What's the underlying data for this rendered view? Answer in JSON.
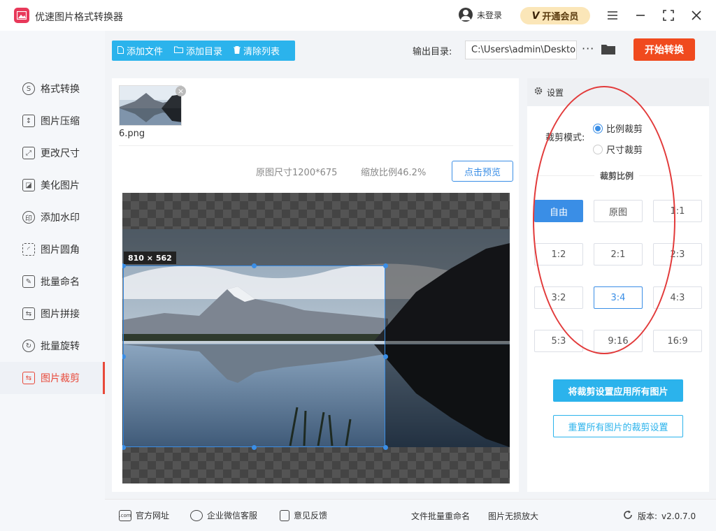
{
  "app": {
    "title": "优速图片格式转换器"
  },
  "header": {
    "login_text": "未登录",
    "vip_mark": "V",
    "vip_label": "开通会员"
  },
  "sidebar": {
    "items": [
      {
        "label": "格式转换",
        "icon": "S"
      },
      {
        "label": "图片压缩",
        "icon": "↕"
      },
      {
        "label": "更改尺寸",
        "icon": "⤢"
      },
      {
        "label": "美化图片",
        "icon": "◪"
      },
      {
        "label": "添加水印",
        "icon": "印"
      },
      {
        "label": "图片圆角",
        "icon": "◜"
      },
      {
        "label": "批量命名",
        "icon": "✎"
      },
      {
        "label": "图片拼接",
        "icon": "⇆"
      },
      {
        "label": "批量旋转",
        "icon": "↻"
      },
      {
        "label": "图片裁剪",
        "icon": "⇆"
      }
    ]
  },
  "toolbar": {
    "add_file": "添加文件",
    "add_dir": "添加目录",
    "clear_list": "清除列表",
    "output_label": "输出目录:",
    "output_path": "C:\\Users\\admin\\Deskto",
    "more": "···",
    "start": "开始转换"
  },
  "file": {
    "name": "6.png",
    "close": "×"
  },
  "preview": {
    "original_size": "原图尺寸1200*675",
    "zoom_ratio": "缩放比例46.2%",
    "preview_button": "点击预览",
    "crop_dimensions": "810 × 562"
  },
  "settings": {
    "header": "设置",
    "mode_label": "裁剪模式:",
    "mode_options": [
      "比例裁剪",
      "尺寸裁剪"
    ],
    "ratio_title": "裁剪比例",
    "ratios": [
      "自由",
      "原图",
      "1:1",
      "1:2",
      "2:1",
      "2:3",
      "3:2",
      "3:4",
      "4:3",
      "5:3",
      "9:16",
      "16:9"
    ],
    "apply_all": "将裁剪设置应用所有图片",
    "reset_all": "重置所有图片的裁剪设置"
  },
  "footer": {
    "site": "官方网址",
    "site_icon": ".com",
    "wechat": "企业微信客服",
    "feedback": "意见反馈",
    "batch_rename": "文件批量重命名",
    "lossless": "图片无损放大",
    "version_label": "版本:",
    "version": "v2.0.7.0"
  },
  "colors": {
    "accent": "#3a8ee6",
    "start": "#f04a1e",
    "toolbar": "#2bb3ec",
    "active_nav": "#e8493a"
  }
}
